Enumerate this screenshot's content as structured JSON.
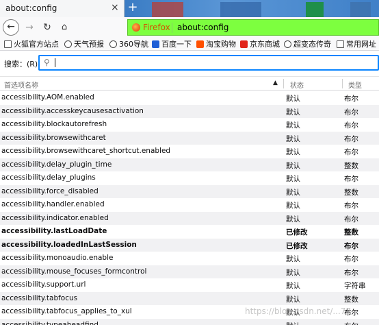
{
  "tab": {
    "title": "about:config",
    "close": "×",
    "new_tab": "+"
  },
  "navbar": {
    "back": "←",
    "forward": "→",
    "reload": "↻",
    "home": "⌂",
    "identity_label": "Firefox",
    "url": "about:config",
    "urlbar_color": "#7dff3f"
  },
  "bookmarks": [
    {
      "label": "火狐官方站点",
      "icon": "folder-icon"
    },
    {
      "label": "天气预报",
      "icon": "globe-icon"
    },
    {
      "label": "360导航",
      "icon": "globe-icon"
    },
    {
      "label": "百度一下",
      "icon": "baidu-paw-icon"
    },
    {
      "label": "淘宝购物",
      "icon": "taobao-icon"
    },
    {
      "label": "京东商城",
      "icon": "jd-icon"
    },
    {
      "label": "超变态传奇",
      "icon": "globe-icon"
    },
    {
      "label": "常用网址",
      "icon": "folder-icon"
    }
  ],
  "search": {
    "label": "搜索：(R)",
    "value": "",
    "icon": "search-icon"
  },
  "table": {
    "headers": {
      "name": "首选项名称",
      "status": "状态",
      "type": "类型",
      "sort_indicator": "▲"
    },
    "rows": [
      {
        "name": "accessibility.AOM.enabled",
        "status": "默认",
        "type": "布尔",
        "modified": false
      },
      {
        "name": "accessibility.accesskeycausesactivation",
        "status": "默认",
        "type": "布尔",
        "modified": false
      },
      {
        "name": "accessibility.blockautorefresh",
        "status": "默认",
        "type": "布尔",
        "modified": false
      },
      {
        "name": "accessibility.browsewithcaret",
        "status": "默认",
        "type": "布尔",
        "modified": false
      },
      {
        "name": "accessibility.browsewithcaret_shortcut.enabled",
        "status": "默认",
        "type": "布尔",
        "modified": false
      },
      {
        "name": "accessibility.delay_plugin_time",
        "status": "默认",
        "type": "整数",
        "modified": false
      },
      {
        "name": "accessibility.delay_plugins",
        "status": "默认",
        "type": "布尔",
        "modified": false
      },
      {
        "name": "accessibility.force_disabled",
        "status": "默认",
        "type": "整数",
        "modified": false
      },
      {
        "name": "accessibility.handler.enabled",
        "status": "默认",
        "type": "布尔",
        "modified": false
      },
      {
        "name": "accessibility.indicator.enabled",
        "status": "默认",
        "type": "布尔",
        "modified": false
      },
      {
        "name": "accessibility.lastLoadDate",
        "status": "已修改",
        "type": "整数",
        "modified": true
      },
      {
        "name": "accessibility.loadedInLastSession",
        "status": "已修改",
        "type": "布尔",
        "modified": true
      },
      {
        "name": "accessibility.monoaudio.enable",
        "status": "默认",
        "type": "布尔",
        "modified": false
      },
      {
        "name": "accessibility.mouse_focuses_formcontrol",
        "status": "默认",
        "type": "布尔",
        "modified": false
      },
      {
        "name": "accessibility.support.url",
        "status": "默认",
        "type": "字符串",
        "modified": false
      },
      {
        "name": "accessibility.tabfocus",
        "status": "默认",
        "type": "整数",
        "modified": false
      },
      {
        "name": "accessibility.tabfocus_applies_to_xul",
        "status": "默认",
        "type": "布尔",
        "modified": false
      },
      {
        "name": "accessibility.typeaheadfind",
        "status": "默认",
        "type": "布尔",
        "modified": false
      }
    ]
  },
  "watermark": "https://blog.csdn.net/...77"
}
